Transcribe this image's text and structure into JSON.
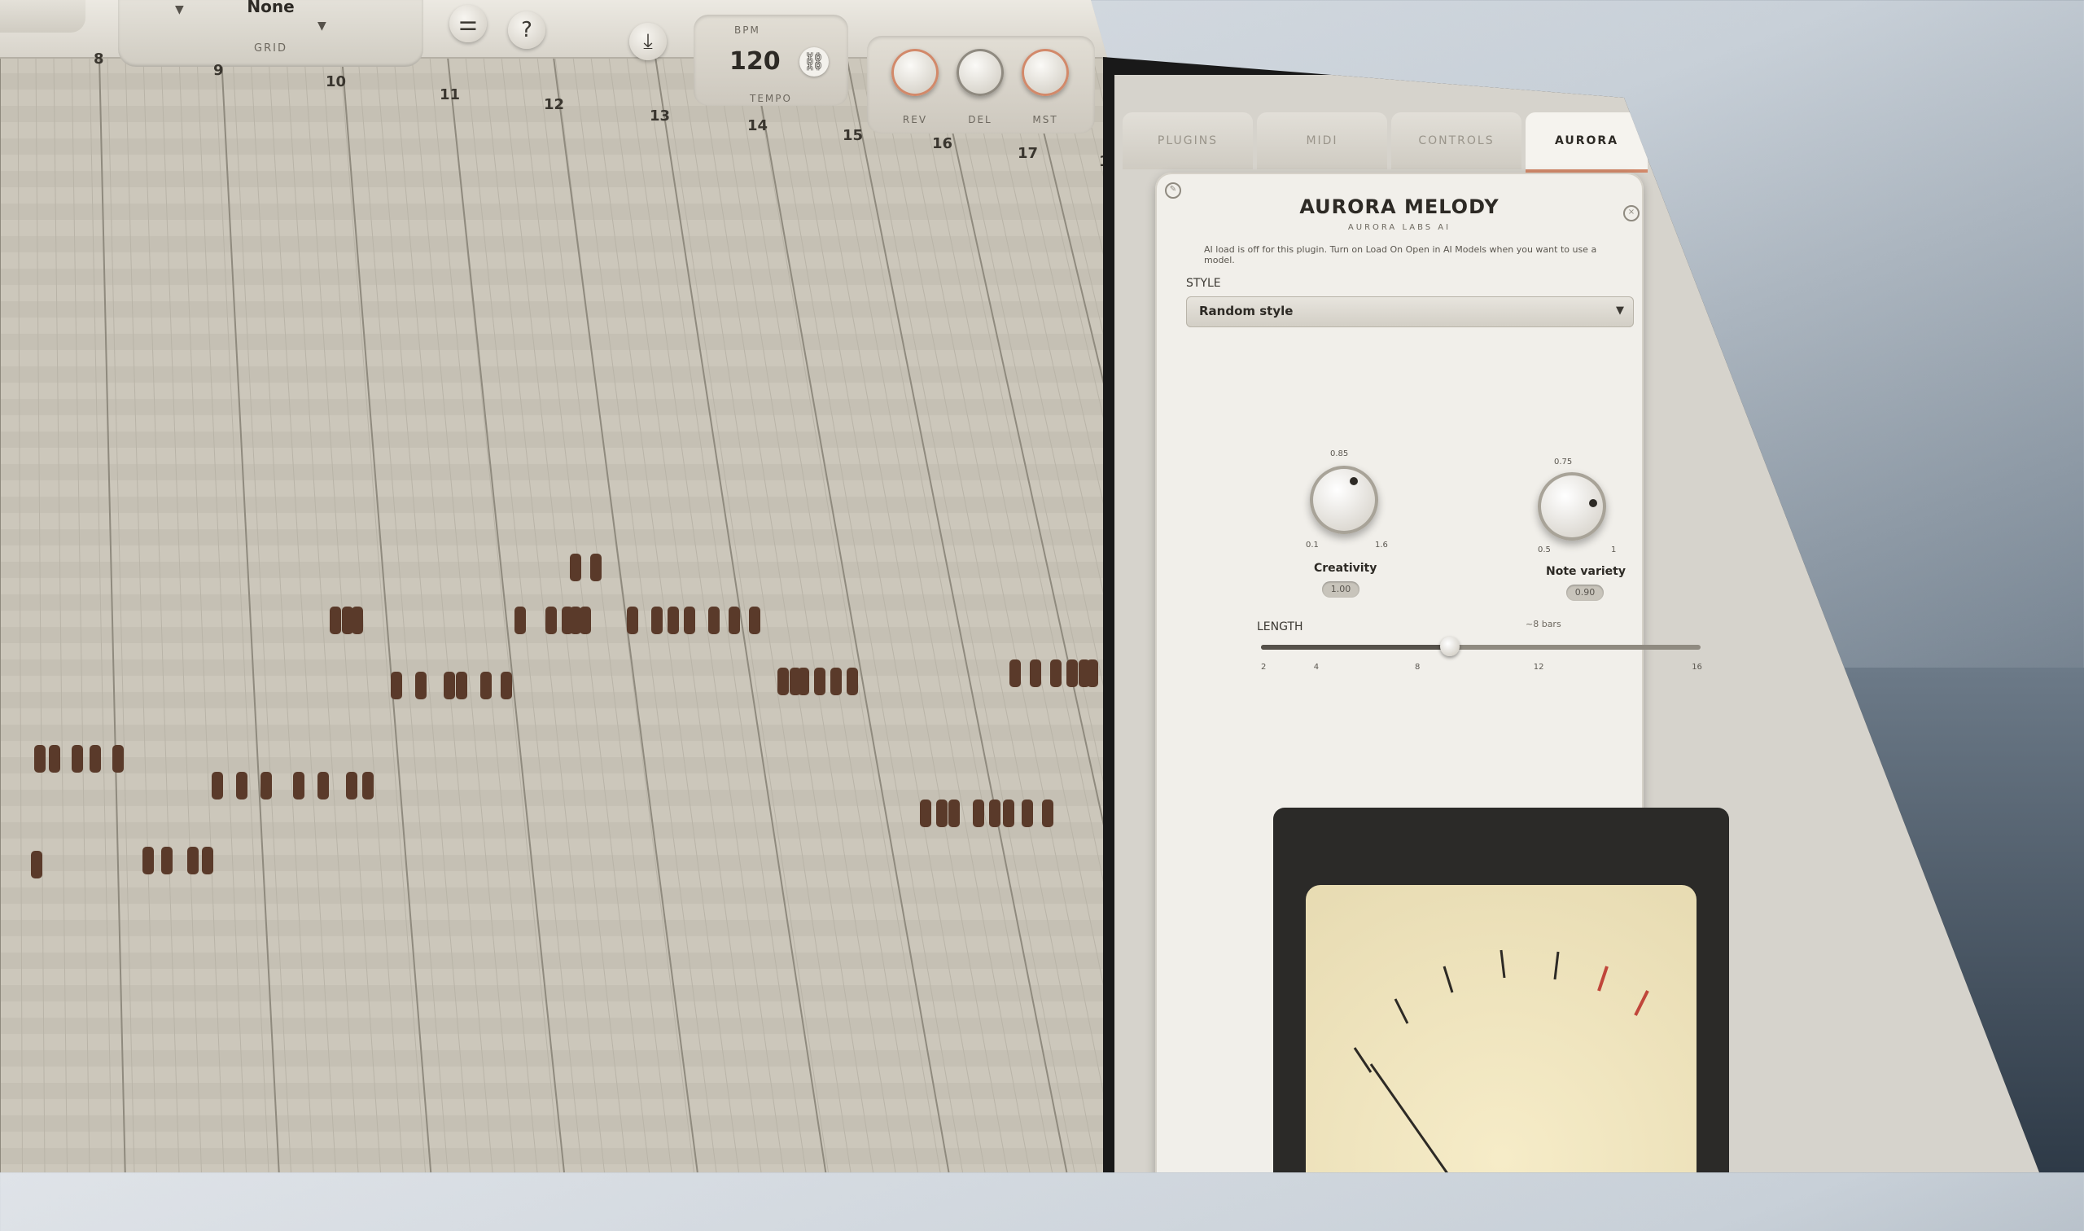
{
  "toolbar": {
    "grid_value": "None",
    "grid_label": "GRID",
    "bpm_label": "BPM",
    "bpm_value": "120",
    "tempo_label": "TEMPO",
    "fx_knobs": [
      {
        "label": "REV"
      },
      {
        "label": "DEL"
      },
      {
        "label": "MST"
      }
    ],
    "icons": [
      "mixer-icon",
      "help-icon",
      "export-icon",
      "link-icon"
    ]
  },
  "ruler": [
    "8",
    "9",
    "10",
    "11",
    "12",
    "13",
    "14",
    "15",
    "16",
    "17",
    "1"
  ],
  "plugin_window": {
    "tabs": [
      {
        "label": "PLUGINS",
        "active": false
      },
      {
        "label": "MIDI",
        "active": false
      },
      {
        "label": "CONTROLS",
        "active": false
      },
      {
        "label": "AURORA",
        "active": true
      }
    ],
    "window_controls": [
      "–",
      "×"
    ],
    "plugin": {
      "title": "AURORA MELODY",
      "vendor": "AURORA LABS AI",
      "info": "AI load is off for this plugin. Turn on Load On Open in AI Models when you want to use a model.",
      "style_label": "STYLE",
      "style_value": "Random style",
      "knobs": [
        {
          "label": "Creativity",
          "value": "1.00",
          "min": "0.1",
          "max": "1.6",
          "top": "0.85",
          "level": 0.6
        },
        {
          "label": "Note variety",
          "value": "0.90",
          "min": "0.5",
          "max": "1",
          "top": "0.75",
          "level": 0.8
        }
      ],
      "length_label": "LENGTH",
      "length_value": "~8 bars",
      "length_ticks": [
        "2",
        "4",
        "8",
        "12",
        "16"
      ],
      "length_level": 0.43
    }
  },
  "colors": {
    "accent": "#d2896a",
    "note": "#5a3a2a",
    "grid_bg": "#ccc7bb"
  }
}
